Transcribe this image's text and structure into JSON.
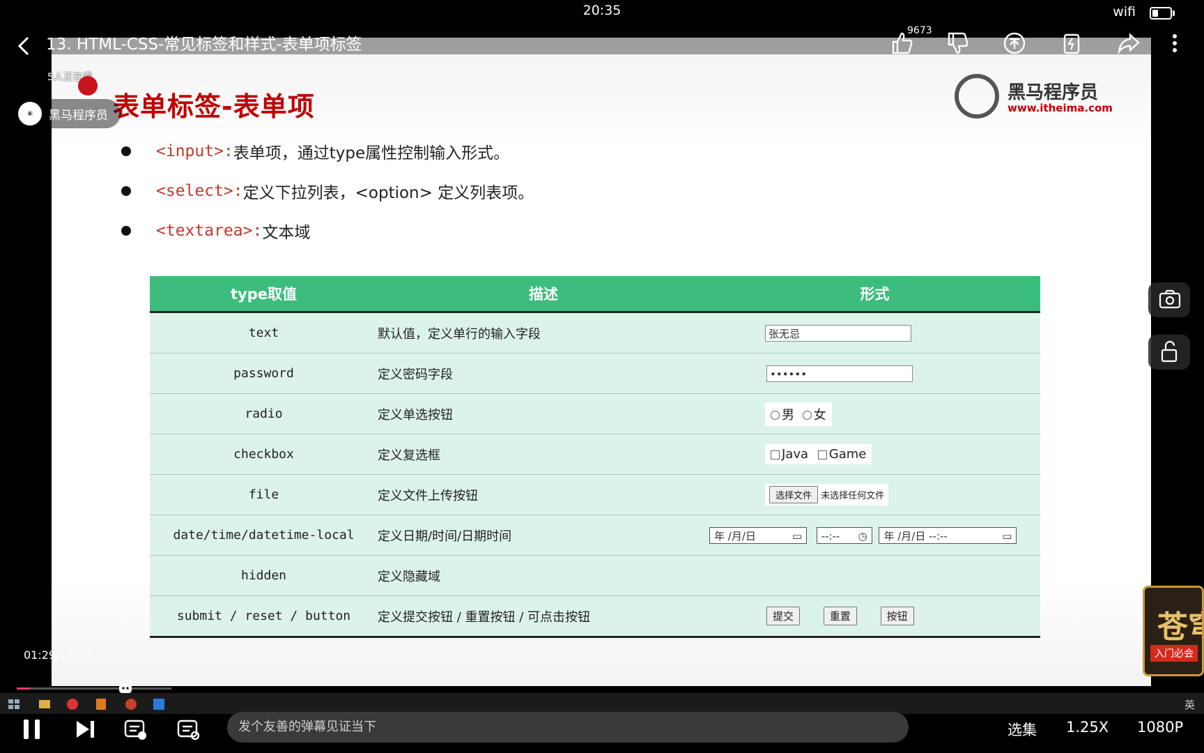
{
  "status_bar": {
    "time": "20:35",
    "wifi_label": "wifi",
    "battery_level": 0.35
  },
  "header": {
    "video_title": "13. HTML-CSS-常见标签和样式-表单项标签",
    "like_count": "9673",
    "viewers": "5人正在看",
    "uploader_name": "黑马程序员"
  },
  "slide": {
    "title": "表单标签-表单项",
    "brand_name": "黑马程序员",
    "brand_url": "www.itheima.com",
    "bullets": [
      {
        "tag": "<input>:",
        "text": " 表单项，通过type属性控制输入形式。"
      },
      {
        "tag": "<select>:",
        "text": " 定义下拉列表，<option> 定义列表项。"
      },
      {
        "tag": "<textarea>:",
        "text": " 文本域"
      }
    ],
    "table": {
      "headers": [
        "type取值",
        "描述",
        "形式"
      ],
      "rows": [
        {
          "type": "text",
          "desc": "默认值，定义单行的输入字段"
        },
        {
          "type": "password",
          "desc": "定义密码字段"
        },
        {
          "type": "radio",
          "desc": "定义单选按钮"
        },
        {
          "type": "checkbox",
          "desc": "定义复选框"
        },
        {
          "type": "file",
          "desc": "定义文件上传按钮"
        },
        {
          "type": "date/time/datetime-local",
          "desc": "定义日期/时间/日期时间"
        },
        {
          "type": "hidden",
          "desc": "定义隐藏域"
        },
        {
          "type": "submit / reset / button",
          "desc": "定义提交按钮 / 重置按钮 / 可点击按钮"
        }
      ],
      "samples": {
        "text_value": "张无忌",
        "password_value": "••••••",
        "radio_options": [
          "男",
          "女"
        ],
        "checkbox_options": [
          "Java",
          "Game"
        ],
        "file_button": "选择文件",
        "file_status": "未选择任何文件",
        "date_placeholder": "年 /月/日",
        "time_placeholder": "--:--",
        "datetime_placeholder": "年 /月/日 --:--",
        "buttons": [
          "提交",
          "重置",
          "按钮"
        ]
      }
    }
  },
  "player": {
    "timecode": "01:29/17:37",
    "progress": 0.085,
    "danmaku_placeholder": "发个友善的弹幕见证当下",
    "episodes_label": "选集",
    "speed_label": "1.25X",
    "quality_label": "1080P",
    "promo_title": "苍穹",
    "promo_tag": "入门必会",
    "ime_label": "英"
  },
  "colors": {
    "table_header": "#3cbd7e",
    "table_row": "#dcf3ea",
    "title_red": "#c00000",
    "progress": "#e23b6d"
  }
}
